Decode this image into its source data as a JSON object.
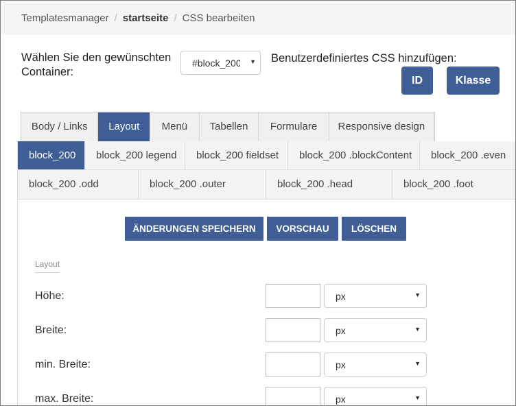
{
  "breadcrumb": {
    "items": [
      "Templatesmanager",
      "startseite",
      "CSS bearbeiten"
    ],
    "separator": "/"
  },
  "container": {
    "label": "Wählen Sie den gewünschten Container:",
    "selected": "#block_200",
    "caret": "▼"
  },
  "custom_css": {
    "label": "Benutzerdefiniertes CSS hinzufügen:",
    "id_button": "ID",
    "class_button": "Klasse"
  },
  "main_tabs": [
    {
      "label": "Body / Links",
      "active": false
    },
    {
      "label": "Layout",
      "active": true
    },
    {
      "label": "Menü",
      "active": false
    },
    {
      "label": "Tabellen",
      "active": false
    },
    {
      "label": "Formulare",
      "active": false
    },
    {
      "label": "Responsive design",
      "active": false
    }
  ],
  "sub_tabs_row1": [
    {
      "label": "block_200",
      "active": true
    },
    {
      "label": "block_200 legend",
      "active": false
    },
    {
      "label": "block_200 fieldset",
      "active": false
    },
    {
      "label": "block_200 .blockContent",
      "active": false
    },
    {
      "label": "block_200 .even",
      "active": false
    }
  ],
  "sub_tabs_row2": [
    {
      "label": "block_200 .odd"
    },
    {
      "label": "block_200 .outer"
    },
    {
      "label": "block_200 .head"
    },
    {
      "label": "block_200 .foot"
    }
  ],
  "actions": {
    "save": "ÄNDERUNGEN SPEICHERN",
    "preview": "VORSCHAU",
    "delete": "LÖSCHEN"
  },
  "section": {
    "legend": "Layout"
  },
  "properties": [
    {
      "label": "Höhe:",
      "value": "",
      "unit": "px"
    },
    {
      "label": "Breite:",
      "value": "",
      "unit": "px"
    },
    {
      "label": "min. Breite:",
      "value": "",
      "unit": "px"
    },
    {
      "label": "max. Breite:",
      "value": "",
      "unit": "px"
    }
  ],
  "colors": {
    "accent": "#3f5e96",
    "breadcrumb_bg": "#f5f5f5",
    "tab_bg": "#f0f0f0"
  }
}
